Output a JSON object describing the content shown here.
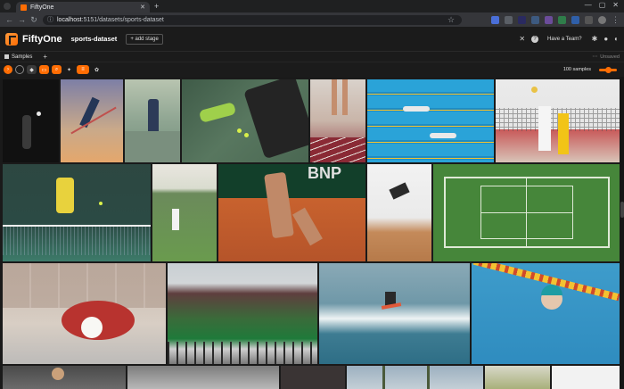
{
  "browser": {
    "tab_title": "FiftyOne",
    "url_host": "localhost",
    "url_path": ":5151/datasets/sports-dataset"
  },
  "app": {
    "brand": "FiftyOne",
    "dataset_name": "sports-dataset",
    "add_stage_label": "+ add stage",
    "team_button": "Have a Team?"
  },
  "panel": {
    "samples_label": "Samples",
    "unsaved_label": "Unsaved"
  },
  "toolbar": {
    "sample_count": "100 samples",
    "zoom_level": 0.5
  },
  "colors": {
    "accent": "#ff6d04",
    "background": "#1a1a1a"
  },
  "icons": [
    "chevron-right-icon",
    "palette-icon",
    "tag-icon",
    "label-tag-icon",
    "search-icon",
    "patches-icon",
    "similarity-icon",
    "settings-icon",
    "close-icon",
    "help-icon",
    "slack-icon",
    "github-icon",
    "theme-icon"
  ]
}
